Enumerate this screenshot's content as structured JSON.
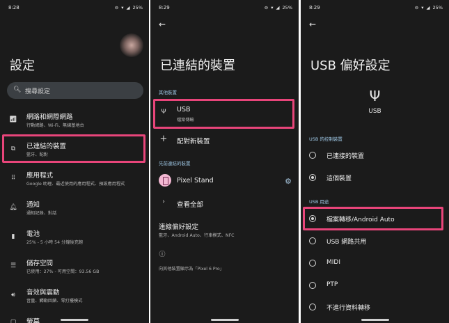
{
  "screen1": {
    "status": {
      "time": "8:28",
      "battery": "25%"
    },
    "title": "設定",
    "search_placeholder": "搜尋設定",
    "items": [
      {
        "icon": "wifi-icon",
        "title": "網路和網際網路",
        "subtitle": "行動網路、Wi-Fi、無線基地台"
      },
      {
        "icon": "connected-devices-icon",
        "title": "已連結的裝置",
        "subtitle": "藍牙、配對"
      },
      {
        "icon": "apps-icon",
        "title": "應用程式",
        "subtitle": "Google 助理、最近使用的應用程式、預設應用程式"
      },
      {
        "icon": "bell-icon",
        "title": "通知",
        "subtitle": "通知記錄、對話"
      },
      {
        "icon": "battery-icon",
        "title": "電池",
        "subtitle": "25% - 5 小時 54 分鐘後充飽"
      },
      {
        "icon": "storage-icon",
        "title": "儲存空間",
        "subtitle": "已使用：27% - 可用空間：93.56 GB"
      },
      {
        "icon": "volume-icon",
        "title": "音效與震動",
        "subtitle": "音量、觸動回饋、零打擾模式"
      },
      {
        "icon": "display-icon",
        "title": "螢幕",
        "subtitle": ""
      }
    ]
  },
  "screen2": {
    "status": {
      "time": "8:29",
      "battery": "25%"
    },
    "title": "已連結的裝置",
    "section_other": "其他裝置",
    "usb_title": "USB",
    "usb_subtitle": "檔案傳輸",
    "pair_new": "配對新裝置",
    "section_previous": "先前連結的裝置",
    "pixel_stand": "Pixel Stand",
    "see_all": "查看全部",
    "pref_title": "連線偏好設定",
    "pref_subtitle": "藍牙、Android Auto、行車模式、NFC",
    "visible_as": "向其他裝置顯示為「Pixel 6 Pro」"
  },
  "screen3": {
    "status": {
      "time": "8:29",
      "battery": "25%"
    },
    "title": "USB 偏好設定",
    "usb_label": "USB",
    "section_control": "USB 的控制裝置",
    "control_options": [
      {
        "label": "已連接的裝置",
        "selected": false
      },
      {
        "label": "這個裝置",
        "selected": true
      }
    ],
    "section_use": "USB 用途",
    "use_options": [
      {
        "label": "檔案轉移/Android Auto",
        "selected": true
      },
      {
        "label": "USB 網路共用",
        "selected": false
      },
      {
        "label": "MIDI",
        "selected": false
      },
      {
        "label": "PTP",
        "selected": false
      },
      {
        "label": "不進行資料轉移",
        "selected": false
      }
    ]
  },
  "colors": {
    "background": "#1b1b1b",
    "highlight": "#e8457a",
    "section_header": "#9fc8e6",
    "search_bg": "#3b3f43"
  }
}
